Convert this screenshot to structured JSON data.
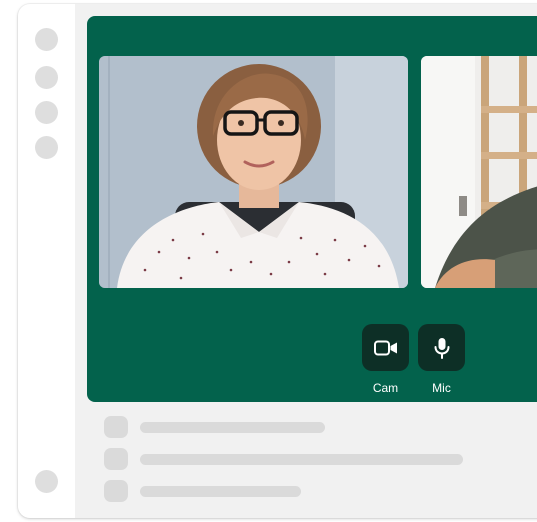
{
  "app": {
    "colors": {
      "call_background": "#03624c",
      "control_button": "#0d2f26",
      "placeholder": "#dadada",
      "sidebar_dot": "#dedede",
      "surface": "#f1f1f1"
    }
  },
  "sidebar": {
    "items": [
      {
        "icon": "nav-dot-icon"
      },
      {
        "icon": "nav-dot-icon"
      },
      {
        "icon": "nav-dot-icon"
      },
      {
        "icon": "nav-dot-icon"
      }
    ],
    "footer_icon": "profile-dot-icon"
  },
  "call": {
    "participants": [
      {
        "name": "",
        "description_icon": "participant-video"
      },
      {
        "name": "",
        "description_icon": "participant-video"
      }
    ],
    "controls": {
      "cam_label": "Cam",
      "cam_icon": "video-camera-icon",
      "mic_label": "Mic",
      "mic_icon": "microphone-icon"
    }
  },
  "chat": {
    "rows": [
      {
        "avatar_icon": "avatar-placeholder",
        "text": ""
      },
      {
        "avatar_icon": "avatar-placeholder",
        "text": ""
      },
      {
        "avatar_icon": "avatar-placeholder",
        "text": ""
      }
    ]
  }
}
